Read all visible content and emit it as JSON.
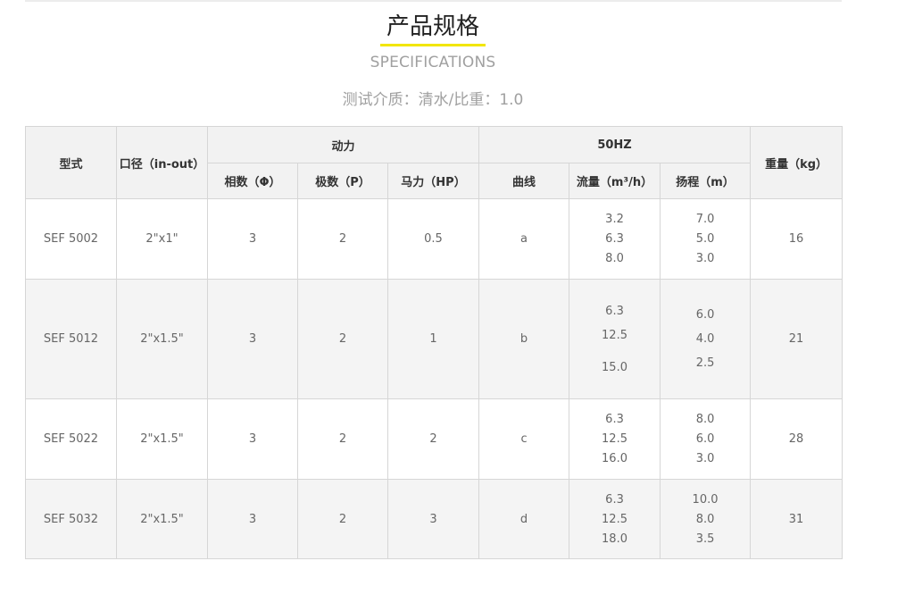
{
  "header": {
    "title": "产品规格",
    "subtitle": "SPECIFICATIONS",
    "test_medium": "测试介质：清水/比重：1.0"
  },
  "table": {
    "headers": {
      "model": "型式",
      "port": "口径（in-out）",
      "power_group": "动力",
      "freq_group": "50HZ",
      "weight": "重量（kg）",
      "phase": "相数（Φ）",
      "poles": "极数（P）",
      "hp": "马力（HP）",
      "curve": "曲线",
      "flow": "流量（m³/h）",
      "head": "扬程（m）"
    },
    "rows": [
      {
        "model": "SEF 5002",
        "port": "2\"x1\"",
        "phase": "3",
        "poles": "2",
        "hp": "0.5",
        "curve": "a",
        "flow": [
          "3.2",
          "6.3",
          "8.0"
        ],
        "head": [
          "7.0",
          "5.0",
          "3.0"
        ],
        "weight": "16"
      },
      {
        "model": "SEF 5012",
        "port": "2\"x1.5\"",
        "phase": "3",
        "poles": "2",
        "hp": "1",
        "curve": "b",
        "flow": [
          "6.3",
          "12.5",
          "15.0"
        ],
        "head": [
          "6.0",
          "4.0",
          "2.5"
        ],
        "weight": "21"
      },
      {
        "model": "SEF 5022",
        "port": "2\"x1.5\"",
        "phase": "3",
        "poles": "2",
        "hp": "2",
        "curve": "c",
        "flow": [
          "6.3",
          "12.5",
          "16.0"
        ],
        "head": [
          "8.0",
          "6.0",
          "3.0"
        ],
        "weight": "28"
      },
      {
        "model": "SEF 5032",
        "port": "2\"x1.5\"",
        "phase": "3",
        "poles": "2",
        "hp": "3",
        "curve": "d",
        "flow": [
          "6.3",
          "12.5",
          "18.0"
        ],
        "head": [
          "10.0",
          "8.0",
          "3.5"
        ],
        "weight": "31"
      }
    ]
  },
  "colors": {
    "accent_underline": "#f2e600",
    "header_bg": "#f2f2f2",
    "alt_row_bg": "#f4f4f4",
    "border": "#d6d6d6"
  }
}
